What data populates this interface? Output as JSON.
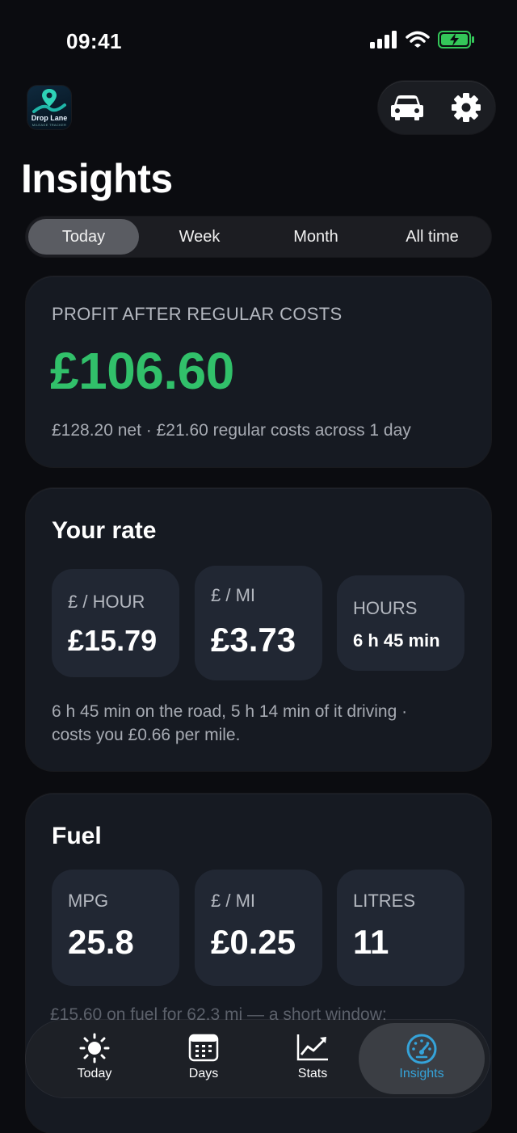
{
  "status": {
    "time": "09:41"
  },
  "app": {
    "logo_name": "Drop Lane",
    "logo_sub": "MILEAGE TRACKER"
  },
  "page": {
    "title": "Insights"
  },
  "tabs": [
    "Today",
    "Week",
    "Month",
    "All time"
  ],
  "selected_tab": "Today",
  "profit_card": {
    "label": "PROFIT AFTER REGULAR COSTS",
    "value": "£106.60",
    "note": "£128.20 net · £21.60 regular costs across 1 day"
  },
  "rate_card": {
    "title": "Your rate",
    "tiles": [
      {
        "label": "£ / HOUR",
        "value": "£15.79"
      },
      {
        "label": "£ / MI",
        "value": "£3.73"
      },
      {
        "label": "HOURS",
        "value": "6 h 45 min"
      }
    ],
    "note_line1": "6 h 45 min on the road, 5 h 14 min of it driving ·",
    "note_line2": "costs you £0.66 per mile."
  },
  "fuel_card": {
    "title": "Fuel",
    "tiles": [
      {
        "label": "MPG",
        "value": "25.8"
      },
      {
        "label": "£ / MI",
        "value": "£0.25"
      },
      {
        "label": "LITRES",
        "value": "11"
      }
    ],
    "note_partial": "£15.60 on fuel for 62.3 mi — a short window;"
  },
  "tab_bar": [
    {
      "label": "Today",
      "icon": "sun-icon"
    },
    {
      "label": "Days",
      "icon": "calendar-icon"
    },
    {
      "label": "Stats",
      "icon": "chart-icon"
    },
    {
      "label": "Insights",
      "icon": "speedometer-icon"
    }
  ],
  "active_nav": "Insights",
  "colors": {
    "accent_green": "#31c06a",
    "accent_blue": "#35a3d9",
    "battery_green": "#34c759"
  }
}
